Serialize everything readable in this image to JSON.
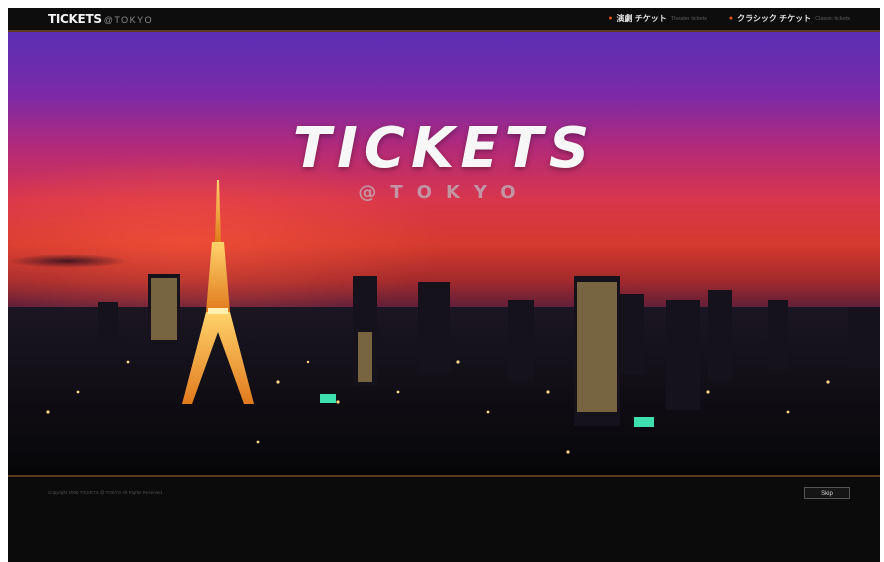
{
  "header": {
    "logo_main": "TICKETS",
    "logo_sub": "@TOKYO",
    "nav": [
      {
        "label": "演劇 チケット",
        "sub": "Theater tickets"
      },
      {
        "label": "クラシック チケット",
        "sub": "Classic tickets"
      }
    ]
  },
  "hero": {
    "title": "TICKETS",
    "subtitle": "@TOKYO"
  },
  "footer": {
    "copyright": "Copyright 2006 TICKETS @ TOKYO All Rights Reserved.",
    "skip_label": "Skip"
  },
  "colors": {
    "accent": "#e0541a",
    "header_bg": "#0d0d0d",
    "divider": "#5a3a1e"
  }
}
